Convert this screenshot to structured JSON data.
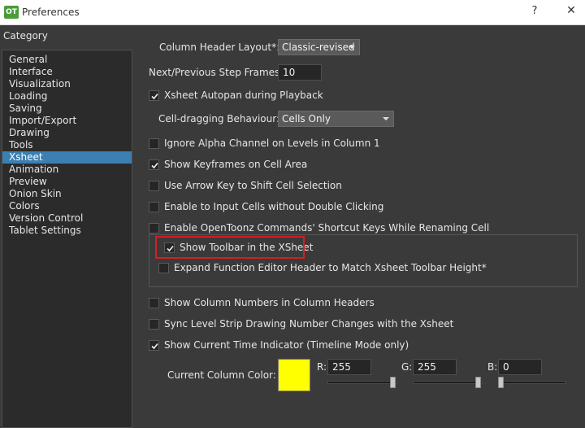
{
  "window": {
    "icon_text": "OT",
    "title": "Preferences",
    "help_label": "?",
    "close_label": "✕"
  },
  "sidebar": {
    "header": "Category",
    "selected": "Xsheet",
    "items": [
      "General",
      "Interface",
      "Visualization",
      "Loading",
      "Saving",
      "Import/Export",
      "Drawing",
      "Tools",
      "Xsheet",
      "Animation",
      "Preview",
      "Onion Skin",
      "Colors",
      "Version Control",
      "Tablet Settings"
    ]
  },
  "settings": {
    "column_header_layout": {
      "label": "Column Header Layout*:",
      "value": "Classic-revised"
    },
    "step_frames": {
      "label": "Next/Previous Step Frames:",
      "value": "10"
    },
    "autopan": {
      "label": "Xsheet Autopan during Playback",
      "checked": true
    },
    "cell_dragging": {
      "label": "Cell-dragging Behaviour:",
      "value": "Cells Only"
    },
    "ignore_alpha": {
      "label": "Ignore Alpha Channel on Levels in Column 1",
      "checked": false
    },
    "show_keyframes": {
      "label": "Show Keyframes on Cell Area",
      "checked": true
    },
    "arrow_key_shift": {
      "label": "Use Arrow Key to Shift Cell Selection",
      "checked": false
    },
    "input_cells": {
      "label": "Enable to Input Cells without Double Clicking",
      "checked": false
    },
    "shortcut_keys": {
      "label": "Enable OpenToonz Commands' Shortcut Keys While Renaming Cell",
      "checked": false
    },
    "show_toolbar": {
      "label": "Show Toolbar in the XSheet",
      "checked": true
    },
    "expand_function_editor": {
      "label": "Expand Function Editor Header to Match Xsheet Toolbar Height*",
      "checked": false
    },
    "column_numbers": {
      "label": "Show Column Numbers in Column Headers",
      "checked": false
    },
    "sync_level_strip": {
      "label": "Sync Level Strip Drawing Number Changes with the Xsheet",
      "checked": false
    },
    "current_time_indicator": {
      "label": "Show Current Time Indicator (Timeline Mode only)",
      "checked": true
    },
    "current_column_color": {
      "label": "Current Column Color:",
      "swatch": "#ffff00",
      "r_label": "R:",
      "r_value": "255",
      "r_fraction": 1.0,
      "g_label": "G:",
      "g_value": "255",
      "g_fraction": 1.0,
      "b_label": "B:",
      "b_value": "0",
      "b_fraction": 0.0
    }
  },
  "colors": {
    "background": "#3a3a3a",
    "selection": "#3c7fb1",
    "highlight_box": "#d01f25",
    "swatch": "#ffff00"
  }
}
